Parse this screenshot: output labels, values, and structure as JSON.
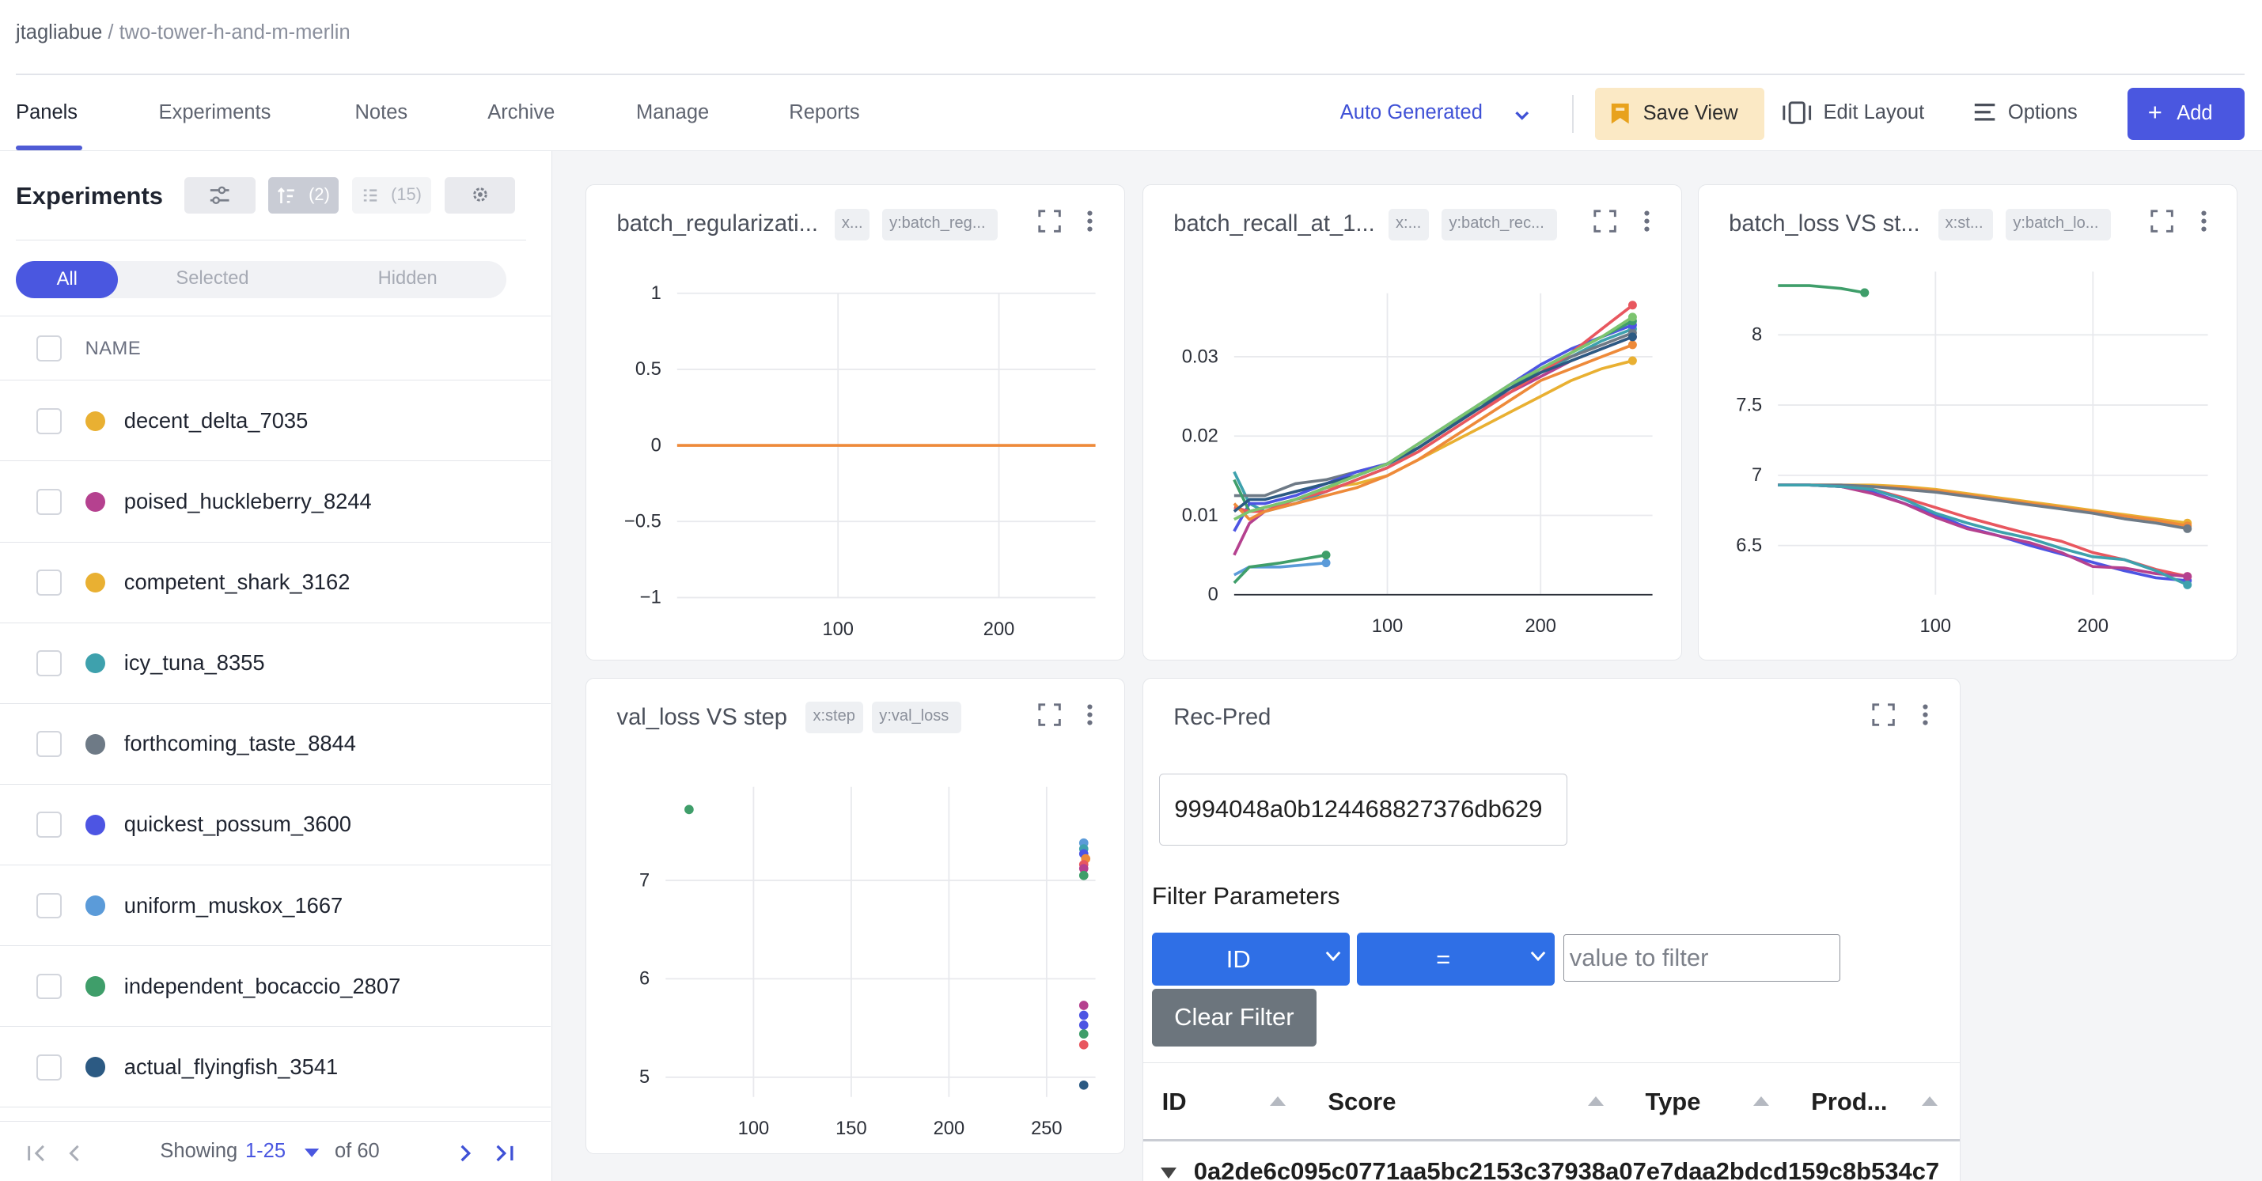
{
  "breadcrumb": {
    "owner": "jtagliabue",
    "separator": " / ",
    "project": "two-tower-h-and-m-merlin"
  },
  "tabs": [
    "Panels",
    "Experiments",
    "Notes",
    "Archive",
    "Manage",
    "Reports"
  ],
  "toolbar": {
    "view_select": "Auto Generated",
    "save_view": "Save View",
    "edit_layout": "Edit Layout",
    "options": "Options",
    "add": "Add"
  },
  "sidebar": {
    "title": "Experiments",
    "sort_count": "(2)",
    "columns_count": "(15)",
    "segments": {
      "all": "All",
      "selected": "Selected",
      "hidden": "Hidden"
    },
    "column_header": "NAME",
    "runs": [
      {
        "name": "decent_delta_7035",
        "color": "#e9b032"
      },
      {
        "name": "poised_huckleberry_8244",
        "color": "#b5418f"
      },
      {
        "name": "competent_shark_3162",
        "color": "#e9b032"
      },
      {
        "name": "icy_tuna_8355",
        "color": "#3ea1ad"
      },
      {
        "name": "forthcoming_taste_8844",
        "color": "#6e7a86"
      },
      {
        "name": "quickest_possum_3600",
        "color": "#4d55e3"
      },
      {
        "name": "uniform_muskox_1667",
        "color": "#5b9bd9"
      },
      {
        "name": "independent_bocaccio_2807",
        "color": "#3f9e6a"
      },
      {
        "name": "actual_flyingfish_3541",
        "color": "#2c5a83"
      }
    ],
    "pager": {
      "showing": "Showing",
      "range": "1-25",
      "of": "of 60"
    }
  },
  "panels": {
    "p1": {
      "title": "batch_regularizati...",
      "chip_x": "x...",
      "chip_y": "y:batch_reg..."
    },
    "p2": {
      "title": "batch_recall_at_1...",
      "chip_x": "x:...",
      "chip_y": "y:batch_rec..."
    },
    "p3": {
      "title": "batch_loss VS st...",
      "chip_x": "x:st...",
      "chip_y": "y:batch_lo..."
    },
    "p4": {
      "title": "val_loss VS step",
      "chip_x": "x:step",
      "chip_y": "y:val_loss"
    },
    "p5": {
      "title": "Rec-Pred"
    }
  },
  "recpred": {
    "input_value": "9994048a0b124468827376db629",
    "filter_label": "Filter Parameters",
    "field_select": "ID",
    "op_select": "=",
    "value_placeholder": "value to filter",
    "clear_button": "Clear Filter",
    "columns": [
      "ID",
      "Score",
      "Type",
      "Prod..."
    ],
    "first_row_id": "0a2de6c095c0771aa5bc2153c37938a07e7daa2bdcd159c8b534c7"
  },
  "chart_data": [
    {
      "type": "line",
      "title": "batch_regularizati...",
      "xticks": [
        100,
        200
      ],
      "yticks": [
        1,
        0.5,
        0,
        -0.5,
        -1
      ],
      "ylim": [
        -1,
        1
      ],
      "series": [
        {
          "color": "#ee8a3a",
          "x": [
            0,
            260
          ],
          "y": [
            0,
            0
          ]
        }
      ]
    },
    {
      "type": "line",
      "title": "batch_recall_at_1...",
      "xticks": [
        100,
        200
      ],
      "yticks": [
        0,
        0.01,
        0.02,
        0.03
      ],
      "ylim": [
        0,
        0.038
      ],
      "series": [
        {
          "color": "#e9b032",
          "x": [
            0,
            10,
            20,
            40,
            60,
            80,
            100,
            120,
            140,
            160,
            180,
            200,
            220,
            240,
            260
          ],
          "y": [
            0.011,
            0.0105,
            0.011,
            0.012,
            0.0135,
            0.014,
            0.015,
            0.017,
            0.019,
            0.021,
            0.023,
            0.025,
            0.027,
            0.0285,
            0.0295
          ]
        },
        {
          "color": "#b5418f",
          "x": [
            0,
            10,
            20,
            40,
            60,
            80,
            100,
            120,
            140,
            160,
            180,
            200,
            220,
            240,
            260
          ],
          "y": [
            0.005,
            0.009,
            0.0105,
            0.012,
            0.0135,
            0.015,
            0.0165,
            0.0185,
            0.021,
            0.0235,
            0.0255,
            0.0275,
            0.0295,
            0.031,
            0.0325
          ]
        },
        {
          "color": "#3ea1ad",
          "x": [
            0,
            10,
            20,
            40,
            60,
            80,
            100,
            120,
            140,
            160,
            180,
            200,
            220,
            240,
            260
          ],
          "y": [
            0.0155,
            0.0115,
            0.0105,
            0.0115,
            0.013,
            0.0145,
            0.016,
            0.0185,
            0.021,
            0.0235,
            0.026,
            0.028,
            0.03,
            0.032,
            0.0335
          ]
        },
        {
          "color": "#6e7a86",
          "x": [
            0,
            10,
            20,
            40,
            60,
            80,
            100,
            120,
            140,
            160,
            180,
            200,
            220,
            240,
            260
          ],
          "y": [
            0.0125,
            0.0125,
            0.0125,
            0.014,
            0.0145,
            0.0155,
            0.0165,
            0.0185,
            0.021,
            0.0235,
            0.026,
            0.0285,
            0.03,
            0.0315,
            0.033
          ]
        },
        {
          "color": "#4d55e3",
          "x": [
            0,
            10,
            20,
            40,
            60,
            80,
            100,
            120,
            140,
            160,
            180,
            200,
            220,
            240,
            260
          ],
          "y": [
            0.008,
            0.0115,
            0.0115,
            0.0125,
            0.014,
            0.0155,
            0.0165,
            0.019,
            0.0215,
            0.024,
            0.0265,
            0.029,
            0.031,
            0.0325,
            0.034
          ]
        },
        {
          "color": "#3f9e6a",
          "x": [
            0,
            10,
            20,
            40,
            60,
            80,
            100,
            120,
            140,
            160,
            180,
            200,
            220,
            240,
            260
          ],
          "y": [
            0.0145,
            0.0105,
            0.011,
            0.012,
            0.0135,
            0.015,
            0.0165,
            0.0185,
            0.021,
            0.024,
            0.026,
            0.0285,
            0.0305,
            0.0325,
            0.0345
          ]
        },
        {
          "color": "#e8575f",
          "x": [
            0,
            10,
            20,
            40,
            60,
            80,
            100,
            120,
            140,
            160,
            180,
            200,
            220,
            240,
            260
          ],
          "y": [
            0.011,
            0.0105,
            0.0105,
            0.012,
            0.013,
            0.0145,
            0.016,
            0.018,
            0.0205,
            0.023,
            0.0255,
            0.028,
            0.0305,
            0.0335,
            0.0365
          ]
        },
        {
          "color": "#ee8a3a",
          "x": [
            0,
            10,
            20,
            40,
            60,
            80,
            100,
            120,
            140,
            160,
            180,
            200,
            220,
            240,
            260
          ],
          "y": [
            0.0115,
            0.0095,
            0.0105,
            0.0115,
            0.0125,
            0.0135,
            0.015,
            0.017,
            0.0195,
            0.022,
            0.0245,
            0.027,
            0.0285,
            0.03,
            0.0315
          ]
        },
        {
          "color": "#2c5a83",
          "x": [
            0,
            10,
            20,
            40,
            60,
            80,
            100,
            120,
            140,
            160,
            180,
            200,
            220,
            240,
            260
          ],
          "y": [
            0.0105,
            0.012,
            0.012,
            0.013,
            0.014,
            0.015,
            0.0165,
            0.0185,
            0.021,
            0.0235,
            0.026,
            0.028,
            0.0295,
            0.031,
            0.0325
          ]
        },
        {
          "color": "#7cc46f",
          "x": [
            0,
            10,
            20,
            40,
            60,
            80,
            100,
            120,
            140,
            160,
            180,
            200,
            220,
            240,
            260
          ],
          "y": [
            0.0095,
            0.0105,
            0.011,
            0.012,
            0.0135,
            0.015,
            0.0165,
            0.019,
            0.0215,
            0.024,
            0.0265,
            0.0285,
            0.0305,
            0.0325,
            0.035
          ]
        },
        {
          "color": "#5b9bd9",
          "x": [
            0,
            10,
            30,
            60
          ],
          "y": [
            0.0025,
            0.0035,
            0.0035,
            0.004
          ]
        },
        {
          "color": "#3f9e6a",
          "x": [
            0,
            10,
            30,
            60
          ],
          "y": [
            0.0015,
            0.0035,
            0.004,
            0.005
          ]
        }
      ]
    },
    {
      "type": "line",
      "title": "batch_loss VS st...",
      "xticks": [
        100,
        200
      ],
      "yticks": [
        6.5,
        7,
        7.5,
        8
      ],
      "ylim": [
        6.15,
        8.45
      ],
      "series": [
        {
          "color": "#3f9e6a",
          "x": [
            0,
            20,
            40,
            55
          ],
          "y": [
            8.35,
            8.35,
            8.33,
            8.3
          ]
        },
        {
          "color": "#e9b032",
          "x": [
            0,
            20,
            40,
            60,
            80,
            100,
            120,
            140,
            160,
            180,
            200,
            220,
            240,
            260
          ],
          "y": [
            6.93,
            6.93,
            6.93,
            6.93,
            6.92,
            6.9,
            6.87,
            6.84,
            6.81,
            6.78,
            6.75,
            6.72,
            6.69,
            6.66
          ]
        },
        {
          "color": "#ee8a3a",
          "x": [
            0,
            20,
            40,
            60,
            80,
            100,
            120,
            140,
            160,
            180,
            200,
            220,
            240,
            260
          ],
          "y": [
            6.93,
            6.93,
            6.93,
            6.92,
            6.91,
            6.89,
            6.86,
            6.83,
            6.8,
            6.77,
            6.74,
            6.71,
            6.68,
            6.64
          ]
        },
        {
          "color": "#6e7a86",
          "x": [
            0,
            20,
            40,
            60,
            80,
            100,
            120,
            140,
            160,
            180,
            200,
            220,
            240,
            260
          ],
          "y": [
            6.93,
            6.93,
            6.93,
            6.92,
            6.9,
            6.88,
            6.85,
            6.82,
            6.79,
            6.76,
            6.73,
            6.69,
            6.66,
            6.62
          ]
        },
        {
          "color": "#e8575f",
          "x": [
            0,
            20,
            40,
            60,
            80,
            100,
            120,
            140,
            160,
            180,
            200,
            220,
            240,
            260
          ],
          "y": [
            6.93,
            6.93,
            6.92,
            6.9,
            6.84,
            6.77,
            6.7,
            6.64,
            6.58,
            6.53,
            6.45,
            6.4,
            6.33,
            6.28
          ]
        },
        {
          "color": "#4d55e3",
          "x": [
            0,
            20,
            40,
            60,
            80,
            100,
            120,
            140,
            160,
            180,
            200,
            220,
            240,
            260
          ],
          "y": [
            6.93,
            6.93,
            6.92,
            6.88,
            6.8,
            6.72,
            6.63,
            6.57,
            6.5,
            6.44,
            6.38,
            6.32,
            6.27,
            6.25
          ]
        },
        {
          "color": "#b5418f",
          "x": [
            0,
            20,
            40,
            60,
            80,
            100,
            120,
            140,
            160,
            180,
            200,
            220,
            240,
            260
          ],
          "y": [
            6.93,
            6.93,
            6.92,
            6.87,
            6.8,
            6.7,
            6.62,
            6.57,
            6.52,
            6.45,
            6.35,
            6.34,
            6.3,
            6.28
          ]
        },
        {
          "color": "#3ea1ad",
          "x": [
            0,
            20,
            40,
            60,
            80,
            100,
            120,
            140,
            160,
            180,
            200,
            220,
            240,
            260
          ],
          "y": [
            6.93,
            6.93,
            6.92,
            6.9,
            6.83,
            6.73,
            6.66,
            6.6,
            6.55,
            6.48,
            6.42,
            6.4,
            6.32,
            6.22
          ]
        }
      ]
    },
    {
      "type": "scatter",
      "title": "val_loss VS step",
      "xticks": [
        100,
        150,
        200,
        250
      ],
      "yticks": [
        5,
        6,
        7
      ],
      "xlim": [
        55,
        275
      ],
      "ylim": [
        4.8,
        7.95
      ],
      "series": [
        {
          "color": "#3f9e6a",
          "x": [
            67
          ],
          "y": [
            7.72
          ]
        },
        {
          "color": "#5b9bd9",
          "x": [
            269
          ],
          "y": [
            7.38
          ]
        },
        {
          "color": "#3ea1ad",
          "x": [
            269
          ],
          "y": [
            7.32
          ]
        },
        {
          "color": "#4d55e3",
          "x": [
            269
          ],
          "y": [
            7.27
          ]
        },
        {
          "color": "#ee8a3a",
          "x": [
            270
          ],
          "y": [
            7.22
          ]
        },
        {
          "color": "#e8575f",
          "x": [
            269
          ],
          "y": [
            7.16
          ]
        },
        {
          "color": "#b5418f",
          "x": [
            269
          ],
          "y": [
            7.12
          ]
        },
        {
          "color": "#3f9e6a",
          "x": [
            269
          ],
          "y": [
            7.05
          ]
        },
        {
          "color": "#b5418f",
          "x": [
            269
          ],
          "y": [
            5.73
          ]
        },
        {
          "color": "#4d55e3",
          "x": [
            269
          ],
          "y": [
            5.63
          ]
        },
        {
          "color": "#4d55e3",
          "x": [
            269
          ],
          "y": [
            5.53
          ]
        },
        {
          "color": "#3f9e6a",
          "x": [
            269
          ],
          "y": [
            5.44
          ]
        },
        {
          "color": "#e8575f",
          "x": [
            269
          ],
          "y": [
            5.33
          ]
        },
        {
          "color": "#2c5a83",
          "x": [
            269
          ],
          "y": [
            4.92
          ]
        }
      ]
    }
  ]
}
